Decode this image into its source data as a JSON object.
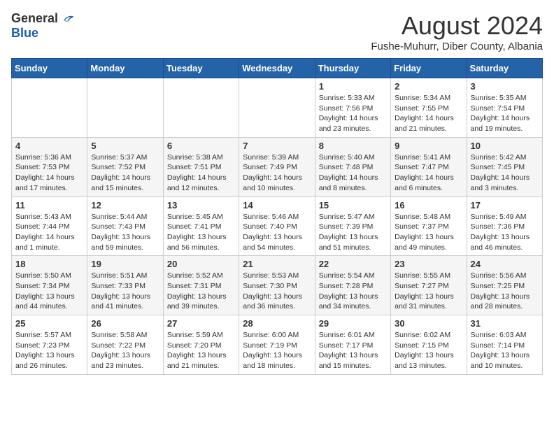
{
  "logo": {
    "general": "General",
    "blue": "Blue"
  },
  "title": "August 2024",
  "location": "Fushe-Muhurr, Diber County, Albania",
  "days_header": [
    "Sunday",
    "Monday",
    "Tuesday",
    "Wednesday",
    "Thursday",
    "Friday",
    "Saturday"
  ],
  "weeks": [
    [
      {
        "day": "",
        "info": ""
      },
      {
        "day": "",
        "info": ""
      },
      {
        "day": "",
        "info": ""
      },
      {
        "day": "",
        "info": ""
      },
      {
        "day": "1",
        "info": "Sunrise: 5:33 AM\nSunset: 7:56 PM\nDaylight: 14 hours\nand 23 minutes."
      },
      {
        "day": "2",
        "info": "Sunrise: 5:34 AM\nSunset: 7:55 PM\nDaylight: 14 hours\nand 21 minutes."
      },
      {
        "day": "3",
        "info": "Sunrise: 5:35 AM\nSunset: 7:54 PM\nDaylight: 14 hours\nand 19 minutes."
      }
    ],
    [
      {
        "day": "4",
        "info": "Sunrise: 5:36 AM\nSunset: 7:53 PM\nDaylight: 14 hours\nand 17 minutes."
      },
      {
        "day": "5",
        "info": "Sunrise: 5:37 AM\nSunset: 7:52 PM\nDaylight: 14 hours\nand 15 minutes."
      },
      {
        "day": "6",
        "info": "Sunrise: 5:38 AM\nSunset: 7:51 PM\nDaylight: 14 hours\nand 12 minutes."
      },
      {
        "day": "7",
        "info": "Sunrise: 5:39 AM\nSunset: 7:49 PM\nDaylight: 14 hours\nand 10 minutes."
      },
      {
        "day": "8",
        "info": "Sunrise: 5:40 AM\nSunset: 7:48 PM\nDaylight: 14 hours\nand 8 minutes."
      },
      {
        "day": "9",
        "info": "Sunrise: 5:41 AM\nSunset: 7:47 PM\nDaylight: 14 hours\nand 6 minutes."
      },
      {
        "day": "10",
        "info": "Sunrise: 5:42 AM\nSunset: 7:45 PM\nDaylight: 14 hours\nand 3 minutes."
      }
    ],
    [
      {
        "day": "11",
        "info": "Sunrise: 5:43 AM\nSunset: 7:44 PM\nDaylight: 14 hours\nand 1 minute."
      },
      {
        "day": "12",
        "info": "Sunrise: 5:44 AM\nSunset: 7:43 PM\nDaylight: 13 hours\nand 59 minutes."
      },
      {
        "day": "13",
        "info": "Sunrise: 5:45 AM\nSunset: 7:41 PM\nDaylight: 13 hours\nand 56 minutes."
      },
      {
        "day": "14",
        "info": "Sunrise: 5:46 AM\nSunset: 7:40 PM\nDaylight: 13 hours\nand 54 minutes."
      },
      {
        "day": "15",
        "info": "Sunrise: 5:47 AM\nSunset: 7:39 PM\nDaylight: 13 hours\nand 51 minutes."
      },
      {
        "day": "16",
        "info": "Sunrise: 5:48 AM\nSunset: 7:37 PM\nDaylight: 13 hours\nand 49 minutes."
      },
      {
        "day": "17",
        "info": "Sunrise: 5:49 AM\nSunset: 7:36 PM\nDaylight: 13 hours\nand 46 minutes."
      }
    ],
    [
      {
        "day": "18",
        "info": "Sunrise: 5:50 AM\nSunset: 7:34 PM\nDaylight: 13 hours\nand 44 minutes."
      },
      {
        "day": "19",
        "info": "Sunrise: 5:51 AM\nSunset: 7:33 PM\nDaylight: 13 hours\nand 41 minutes."
      },
      {
        "day": "20",
        "info": "Sunrise: 5:52 AM\nSunset: 7:31 PM\nDaylight: 13 hours\nand 39 minutes."
      },
      {
        "day": "21",
        "info": "Sunrise: 5:53 AM\nSunset: 7:30 PM\nDaylight: 13 hours\nand 36 minutes."
      },
      {
        "day": "22",
        "info": "Sunrise: 5:54 AM\nSunset: 7:28 PM\nDaylight: 13 hours\nand 34 minutes."
      },
      {
        "day": "23",
        "info": "Sunrise: 5:55 AM\nSunset: 7:27 PM\nDaylight: 13 hours\nand 31 minutes."
      },
      {
        "day": "24",
        "info": "Sunrise: 5:56 AM\nSunset: 7:25 PM\nDaylight: 13 hours\nand 28 minutes."
      }
    ],
    [
      {
        "day": "25",
        "info": "Sunrise: 5:57 AM\nSunset: 7:23 PM\nDaylight: 13 hours\nand 26 minutes."
      },
      {
        "day": "26",
        "info": "Sunrise: 5:58 AM\nSunset: 7:22 PM\nDaylight: 13 hours\nand 23 minutes."
      },
      {
        "day": "27",
        "info": "Sunrise: 5:59 AM\nSunset: 7:20 PM\nDaylight: 13 hours\nand 21 minutes."
      },
      {
        "day": "28",
        "info": "Sunrise: 6:00 AM\nSunset: 7:19 PM\nDaylight: 13 hours\nand 18 minutes."
      },
      {
        "day": "29",
        "info": "Sunrise: 6:01 AM\nSunset: 7:17 PM\nDaylight: 13 hours\nand 15 minutes."
      },
      {
        "day": "30",
        "info": "Sunrise: 6:02 AM\nSunset: 7:15 PM\nDaylight: 13 hours\nand 13 minutes."
      },
      {
        "day": "31",
        "info": "Sunrise: 6:03 AM\nSunset: 7:14 PM\nDaylight: 13 hours\nand 10 minutes."
      }
    ]
  ]
}
